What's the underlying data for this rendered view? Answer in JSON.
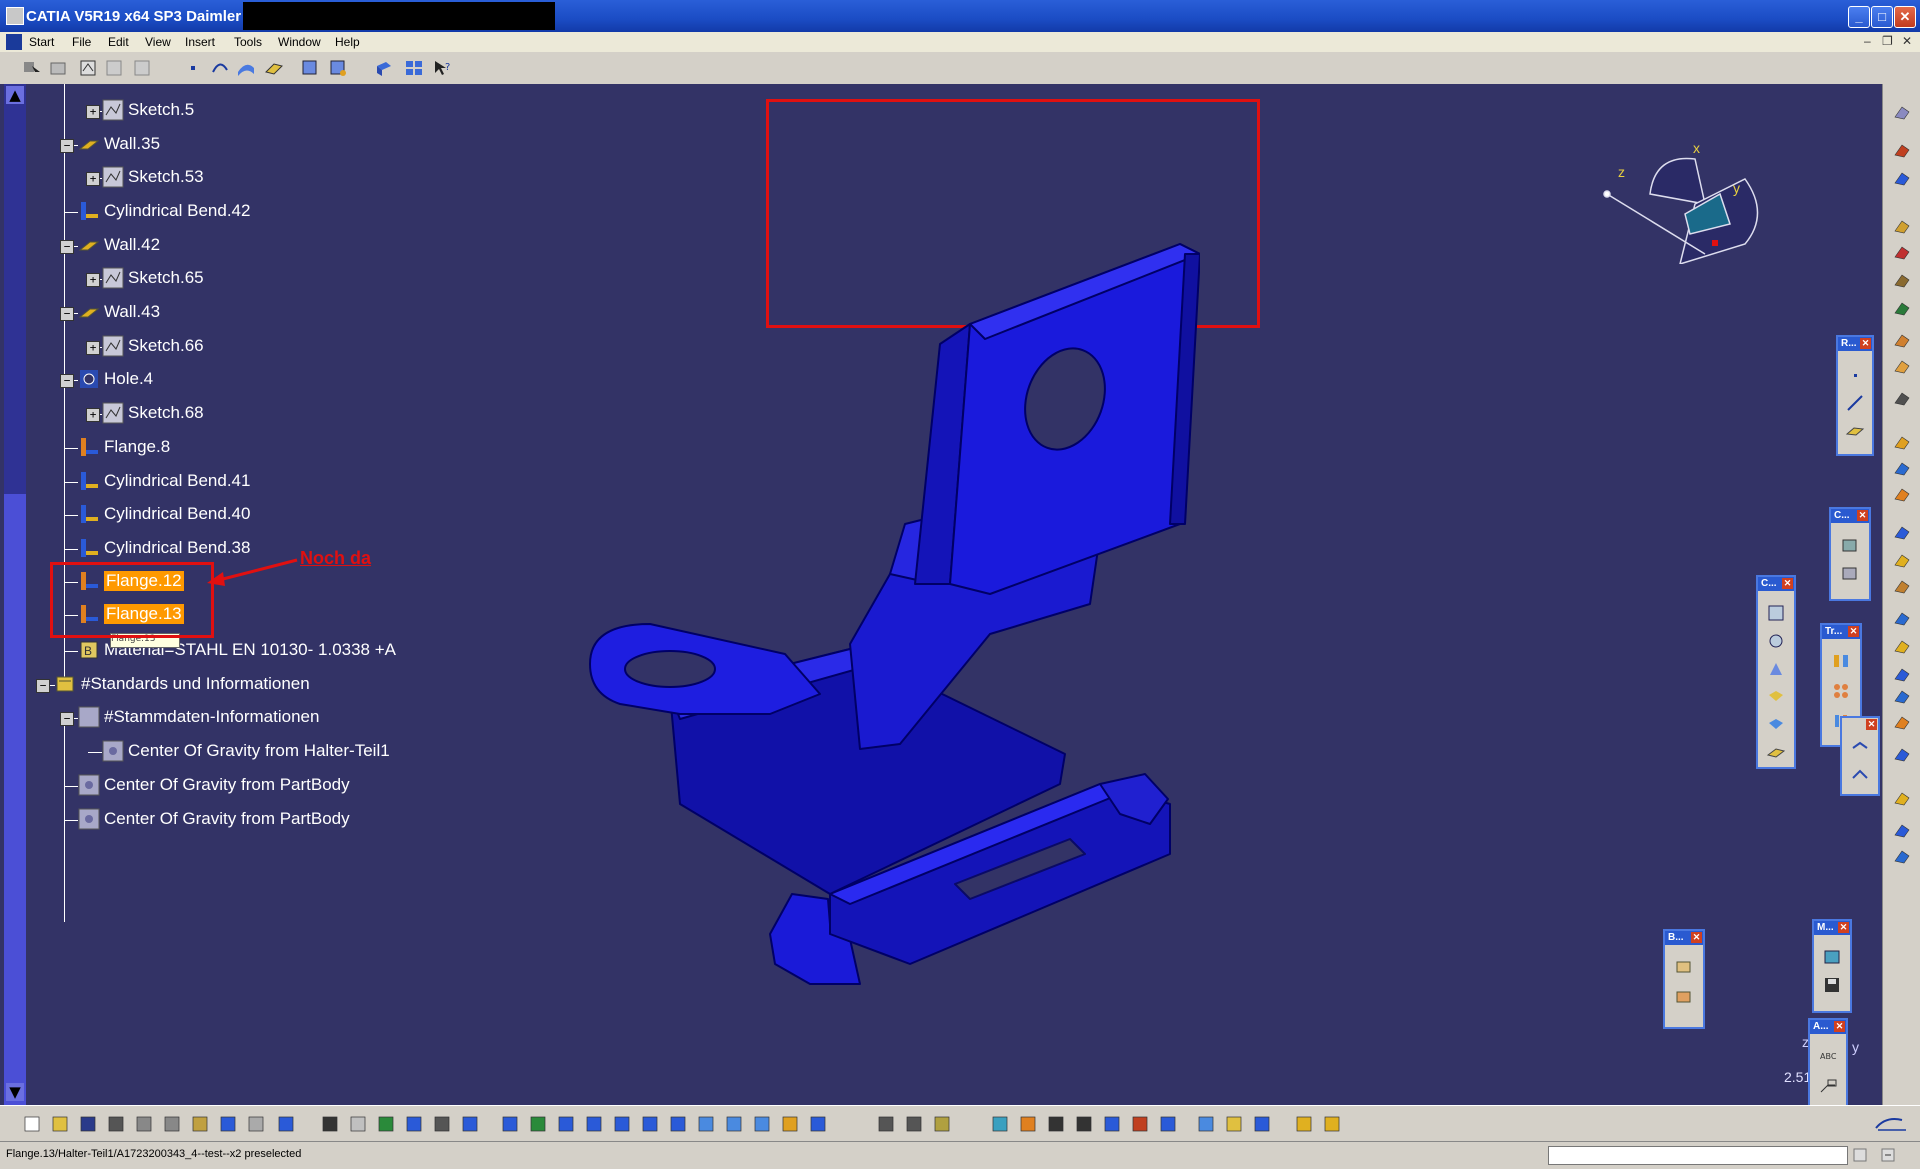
{
  "window": {
    "title": "CATIA V5R19 x64 SP3 Daimler AG -"
  },
  "menu": [
    "Start",
    "File",
    "Edit",
    "View",
    "Insert",
    "Tools",
    "Window",
    "Help"
  ],
  "tree": {
    "nodes": [
      {
        "label": "Sketch.5",
        "icon": "sketch-icon"
      },
      {
        "label": "Wall.35",
        "icon": "wall-icon"
      },
      {
        "label": "Sketch.53",
        "icon": "sketch-icon"
      },
      {
        "label": "Cylindrical Bend.42",
        "icon": "cylindrical-bend-icon"
      },
      {
        "label": "Wall.42",
        "icon": "wall-icon"
      },
      {
        "label": "Sketch.65",
        "icon": "sketch-icon"
      },
      {
        "label": "Wall.43",
        "icon": "wall-icon"
      },
      {
        "label": "Sketch.66",
        "icon": "sketch-icon"
      },
      {
        "label": "Hole.4",
        "icon": "hole-icon"
      },
      {
        "label": "Sketch.68",
        "icon": "sketch-icon"
      },
      {
        "label": "Flange.8",
        "icon": "flange-icon"
      },
      {
        "label": "Cylindrical Bend.41",
        "icon": "cylindrical-bend-icon"
      },
      {
        "label": "Cylindrical Bend.40",
        "icon": "cylindrical-bend-icon"
      },
      {
        "label": "Cylindrical Bend.38",
        "icon": "cylindrical-bend-icon"
      },
      {
        "label": "Flange.12",
        "icon": "flange-icon",
        "selected": true
      },
      {
        "label": "Flange.13",
        "icon": "flange-icon",
        "selected": true
      },
      {
        "label": "Material=STAHL EN 10130- 1.0338   +A",
        "icon": "material-icon"
      },
      {
        "label": "#Standards und Informationen",
        "icon": "standards-icon"
      },
      {
        "label": "#Stammdaten-Informationen",
        "icon": "parameters-icon"
      },
      {
        "label": "Center Of Gravity from Halter-Teil1",
        "icon": "gravity-icon"
      },
      {
        "label": "Center Of Gravity from PartBody",
        "icon": "gravity-icon"
      },
      {
        "label": "Center Of Gravity from PartBody",
        "icon": "gravity-icon"
      }
    ],
    "tooltip": "Flange.13"
  },
  "annotation": {
    "text": "Noch da",
    "color": "#e01010"
  },
  "compass": {
    "x": "x",
    "y": "y",
    "z": "z"
  },
  "axis_small": {
    "z": "z",
    "y": "y"
  },
  "scale_text": "2.51",
  "floating_toolbars": [
    "R...",
    "C...",
    "C...",
    "Tr...",
    "B...",
    "M...",
    "A..."
  ],
  "status": {
    "message": "Flange.13/Halter-Teil1/A1723200343_4--test--x2 preselected"
  },
  "colors": {
    "viewport_bg": "#333366",
    "part_blue": "#1a1ad8",
    "selection": "#ff9900"
  }
}
